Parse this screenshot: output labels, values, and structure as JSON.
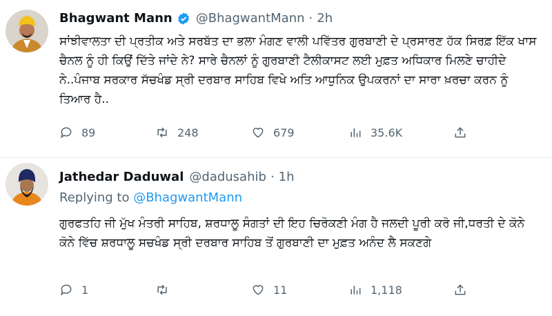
{
  "tweets": [
    {
      "name": "Bhagwant Mann",
      "handle": "@BhagwantMann",
      "time": "2h",
      "text": "ਸਾਂਝੀਵਾਲਤਾ ਦੀ ਪ੍ਰਤੀਕ ਅਤੇ ਸਰਬੱਤ ਦਾ ਭਲਾ ਮੰਗਣ ਵਾਲੀ ਪਵਿੱਤਰ ਗੁਰਬਾਣੀ ਦੇ ਪ੍ਰਸਾਰਣ ਹੱਕ ਸਿਰਫ਼ ਇੱਕ ਖਾਸ ਚੈਨਲ ਨੂੰ ਹੀ ਕਿਉਂ ਦਿੱਤੇ ਜਾਂਦੇ ਨੇ? ਸਾਰੇ ਚੈਨਲਾਂ ਨੂੰ ਗੁਰਬਾਣੀ ਟੈਲੀਕਾਸਟ ਲਈ ਮੁਫ਼ਤ ਅਧਿਕਾਰ ਮਿਲਣੇ ਚਾਹੀਦੇ ਨੇ..ਪੰਜਾਬ ਸਰਕਾਰ ਸੱਚਖੰਡ ਸ੍ਰੀ ਦਰਬਾਰ ਸਾਹਿਬ ਵਿਖੇ ਅਤਿ ਆਧੁਨਿਕ ਉਪਕਰਨਾਂ ਦਾ ਸਾਰਾ ਖ਼ਰਚਾ ਕਰਨ ਨੂੰ ਤਿਆਰ ਹੈ..",
      "replies": "89",
      "retweets": "248",
      "likes": "679",
      "views": "35.6K"
    },
    {
      "name": "Jathedar Daduwal",
      "handle": "@dadusahib",
      "time": "1h",
      "replying_prefix": "Replying to ",
      "replying_to": "@BhagwantMann",
      "text": "ਗੁਰਫਤਹਿ ਜੀ ਮੁੱਖ ਮੰਤਰੀ ਸਾਹਿਬ, ਸ਼ਰਧਾਲੂ ਸੰਗਤਾਂ ਦੀ ਇਹ ਚਿਰੋਕਣੀ ਮੰਗ ਹੈ ਜਲਦੀ ਪੂਰੀ ਕਰੋ ਜੀ,ਧਰਤੀ ਦੇ ਕੋਨੇ ਕੋਨੇ ਵਿੱਚ ਸ਼ਰਧਾਲੂ ਸਚਖੰਡ ਸ੍ਰੀ ਦਰਬਾਰ ਸਾਹਿਬ ਤੋਂ ਗੁਰਬਾਣੀ ਦਾ ਮੁਫ਼ਤ ਅਨੰਦ ਲੈ ਸਕਣਗੇ",
      "replies": "1",
      "retweets": "",
      "likes": "11",
      "views": "1,118"
    }
  ],
  "colors": {
    "accent": "#1d9bf0",
    "muted": "#536471",
    "text": "#0f1419"
  },
  "icons": [
    "verified-badge-icon",
    "reply-icon",
    "retweet-icon",
    "like-icon",
    "views-icon",
    "share-icon"
  ]
}
